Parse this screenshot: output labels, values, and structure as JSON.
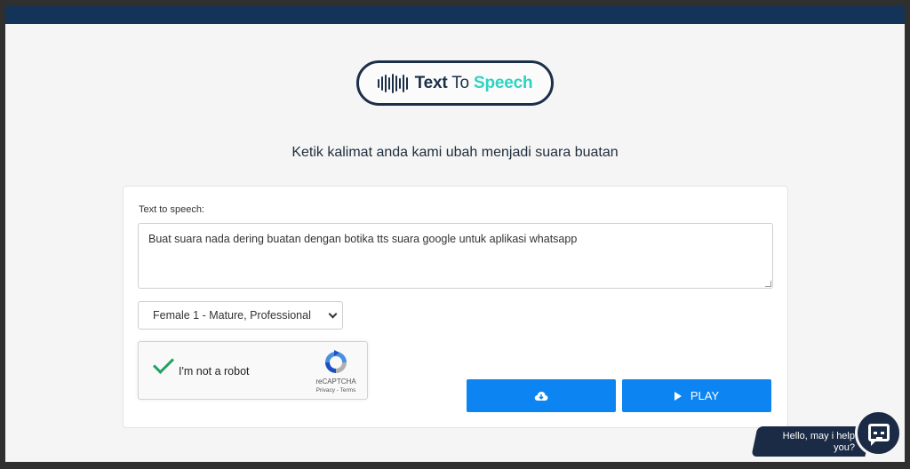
{
  "logo": {
    "text_bold": "Text",
    "text_to": "To",
    "text_speech": "Speech",
    "icon": "sound-wave-icon"
  },
  "subtitle": "Ketik kalimat anda kami ubah menjadi suara buatan",
  "form": {
    "label": "Text to speech:",
    "text_value": "Buat suara nada dering buatan dengan botika tts suara google untuk aplikasi whatsapp",
    "voice_selected": "Female 1 - Mature, Professional"
  },
  "recaptcha": {
    "label": "I'm not a robot",
    "brand": "reCAPTCHA",
    "links": "Privacy - Terms"
  },
  "buttons": {
    "download_icon": "cloud-download-icon",
    "play_label": "PLAY",
    "play_icon": "play-icon"
  },
  "chat": {
    "message": "Hello, may i help you?",
    "icon": "chat-bot-icon"
  },
  "colors": {
    "topbar": "#133358",
    "accent": "#0c84f2",
    "logo_accent": "#2ed3c0",
    "dark": "#1c2f48"
  }
}
